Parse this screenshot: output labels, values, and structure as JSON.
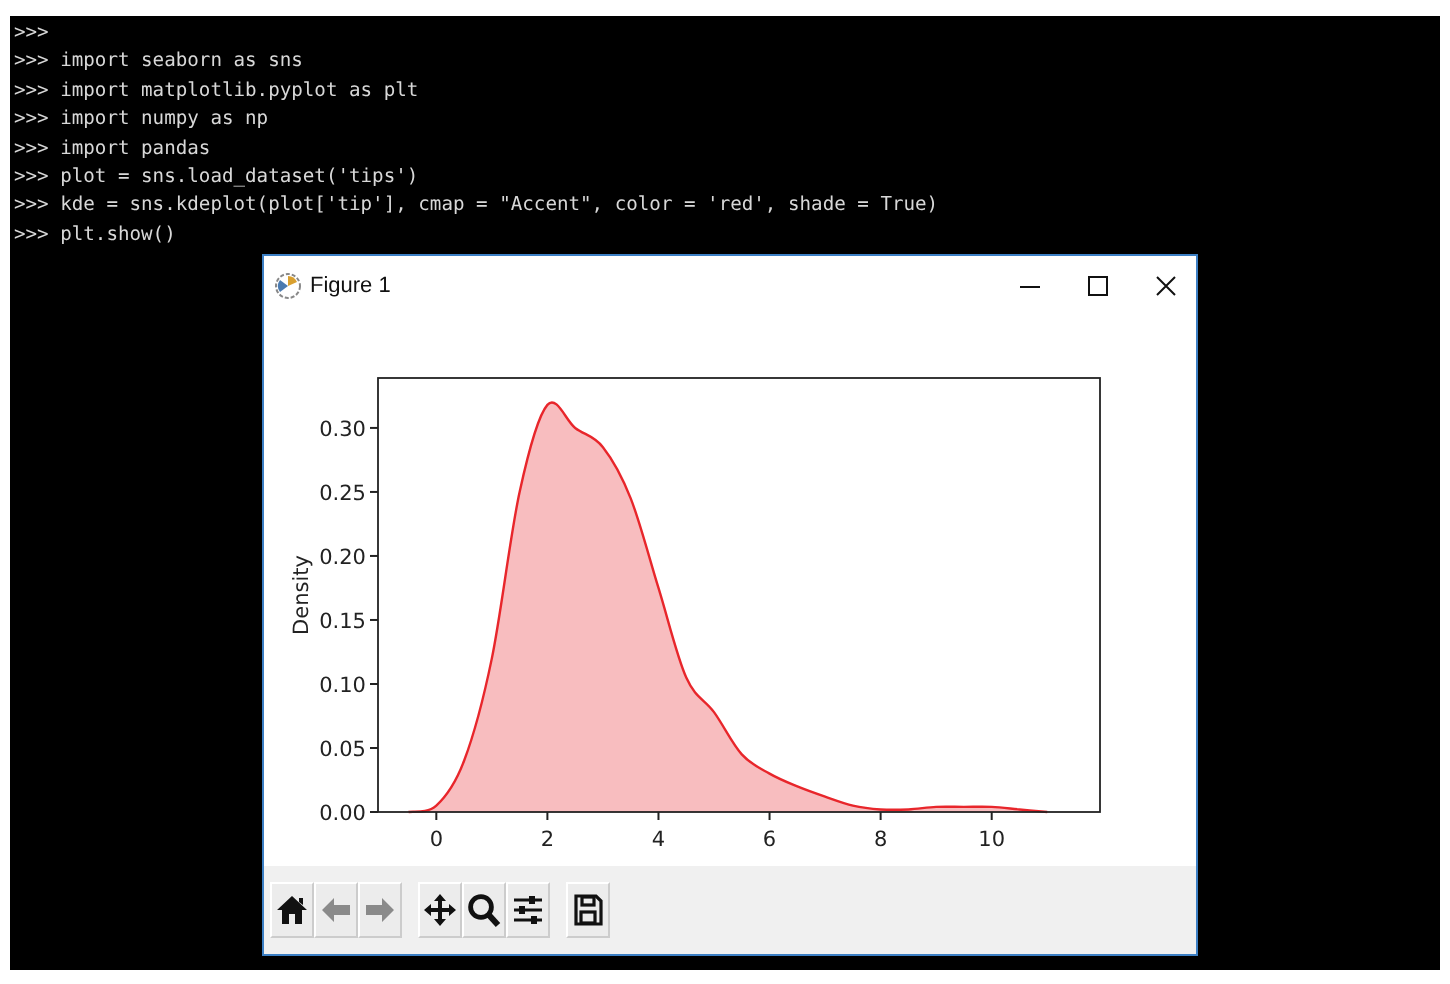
{
  "terminal": {
    "lines": [
      ">>>",
      ">>> import seaborn as sns",
      ">>> import matplotlib.pyplot as plt",
      ">>> import numpy as np",
      ">>> import pandas",
      ">>> plot = sns.load_dataset('tips')",
      ">>> kde = sns.kdeplot(plot['tip'], cmap = \"Accent\", color = 'red', shade = True)",
      ">>> plt.show()"
    ]
  },
  "figure_window": {
    "title": "Figure 1",
    "chart_data": {
      "type": "area",
      "ylabel": "Density",
      "x": [
        -0.5,
        0,
        0.5,
        1,
        1.5,
        2,
        2.5,
        3,
        3.5,
        4,
        4.5,
        5,
        5.5,
        6,
        6.5,
        7,
        7.5,
        8,
        8.5,
        9,
        9.5,
        10,
        10.5,
        11
      ],
      "series": [
        {
          "color": "#e8262b",
          "values": [
            0,
            0.005,
            0.04,
            0.12,
            0.25,
            0.318,
            0.3,
            0.285,
            0.245,
            0.175,
            0.105,
            0.078,
            0.045,
            0.03,
            0.02,
            0.012,
            0.005,
            0.002,
            0.002,
            0.004,
            0.004,
            0.004,
            0.002,
            0
          ]
        }
      ],
      "xlim": [
        -1.05,
        11.95
      ],
      "ylim": [
        0,
        0.339
      ],
      "xticks": [
        {
          "value": 0,
          "label": "0"
        },
        {
          "value": 2,
          "label": "2"
        },
        {
          "value": 4,
          "label": "4"
        },
        {
          "value": 6,
          "label": "6"
        },
        {
          "value": 8,
          "label": "8"
        },
        {
          "value": 10,
          "label": "10"
        }
      ],
      "yticks": [
        {
          "value": 0,
          "label": "0.00"
        },
        {
          "value": 0.05,
          "label": "0.05"
        },
        {
          "value": 0.1,
          "label": "0.10"
        },
        {
          "value": 0.15,
          "label": "0.15"
        },
        {
          "value": 0.2,
          "label": "0.20"
        },
        {
          "value": 0.25,
          "label": "0.25"
        },
        {
          "value": 0.3,
          "label": "0.30"
        }
      ]
    },
    "toolbar": [
      {
        "kind": "home",
        "disabled": false
      },
      {
        "kind": "back",
        "disabled": true
      },
      {
        "kind": "forward",
        "disabled": true
      },
      {
        "kind": "pan",
        "disabled": false
      },
      {
        "kind": "zoom",
        "disabled": false
      },
      {
        "kind": "configure",
        "disabled": false
      },
      {
        "kind": "save",
        "disabled": false
      }
    ]
  }
}
